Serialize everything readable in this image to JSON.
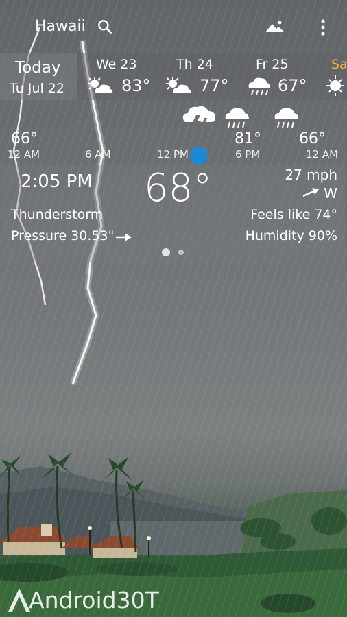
{
  "header": {
    "city": "Hawaii",
    "icons": [
      "search-icon",
      "landscape-icon",
      "more-vert-icon"
    ]
  },
  "forecast": {
    "today": {
      "label": "Today",
      "date": "Tu Jul 22"
    },
    "days": [
      {
        "name": "We 23",
        "temp": "83°",
        "icon": "partly-sunny-icon"
      },
      {
        "name": "Th 24",
        "temp": "77°",
        "icon": "partly-sunny-icon"
      },
      {
        "name": "Fr 25",
        "temp": "67°",
        "icon": "rain-icon"
      },
      {
        "name": "Sa",
        "temp": "",
        "icon": "sun-icon"
      }
    ]
  },
  "hourly": {
    "temps": [
      "66°",
      "81°",
      "66°"
    ],
    "labels": [
      "12 AM",
      "6 AM",
      "12 PM",
      "6 PM",
      "12 AM"
    ],
    "icons": [
      "thunderstorm-icon",
      "rain-icon",
      "rain-icon"
    ]
  },
  "current": {
    "time": "2:05 PM",
    "temp": "68°",
    "wind_speed": "27 mph",
    "wind_dir": "W",
    "condition": "Thunderstorm",
    "feels_like": "Feels like 74°",
    "pressure": "Pressure 30.53\"",
    "humidity": "Humidity 90%",
    "page_indicator": {
      "pages": 2,
      "active": 1
    }
  },
  "watermark": "Android30T",
  "colors": {
    "accent_dot": "#1e88d6",
    "saturday_label": "#f5b041",
    "sky": "#6d7072",
    "grass": "#2f5133"
  }
}
